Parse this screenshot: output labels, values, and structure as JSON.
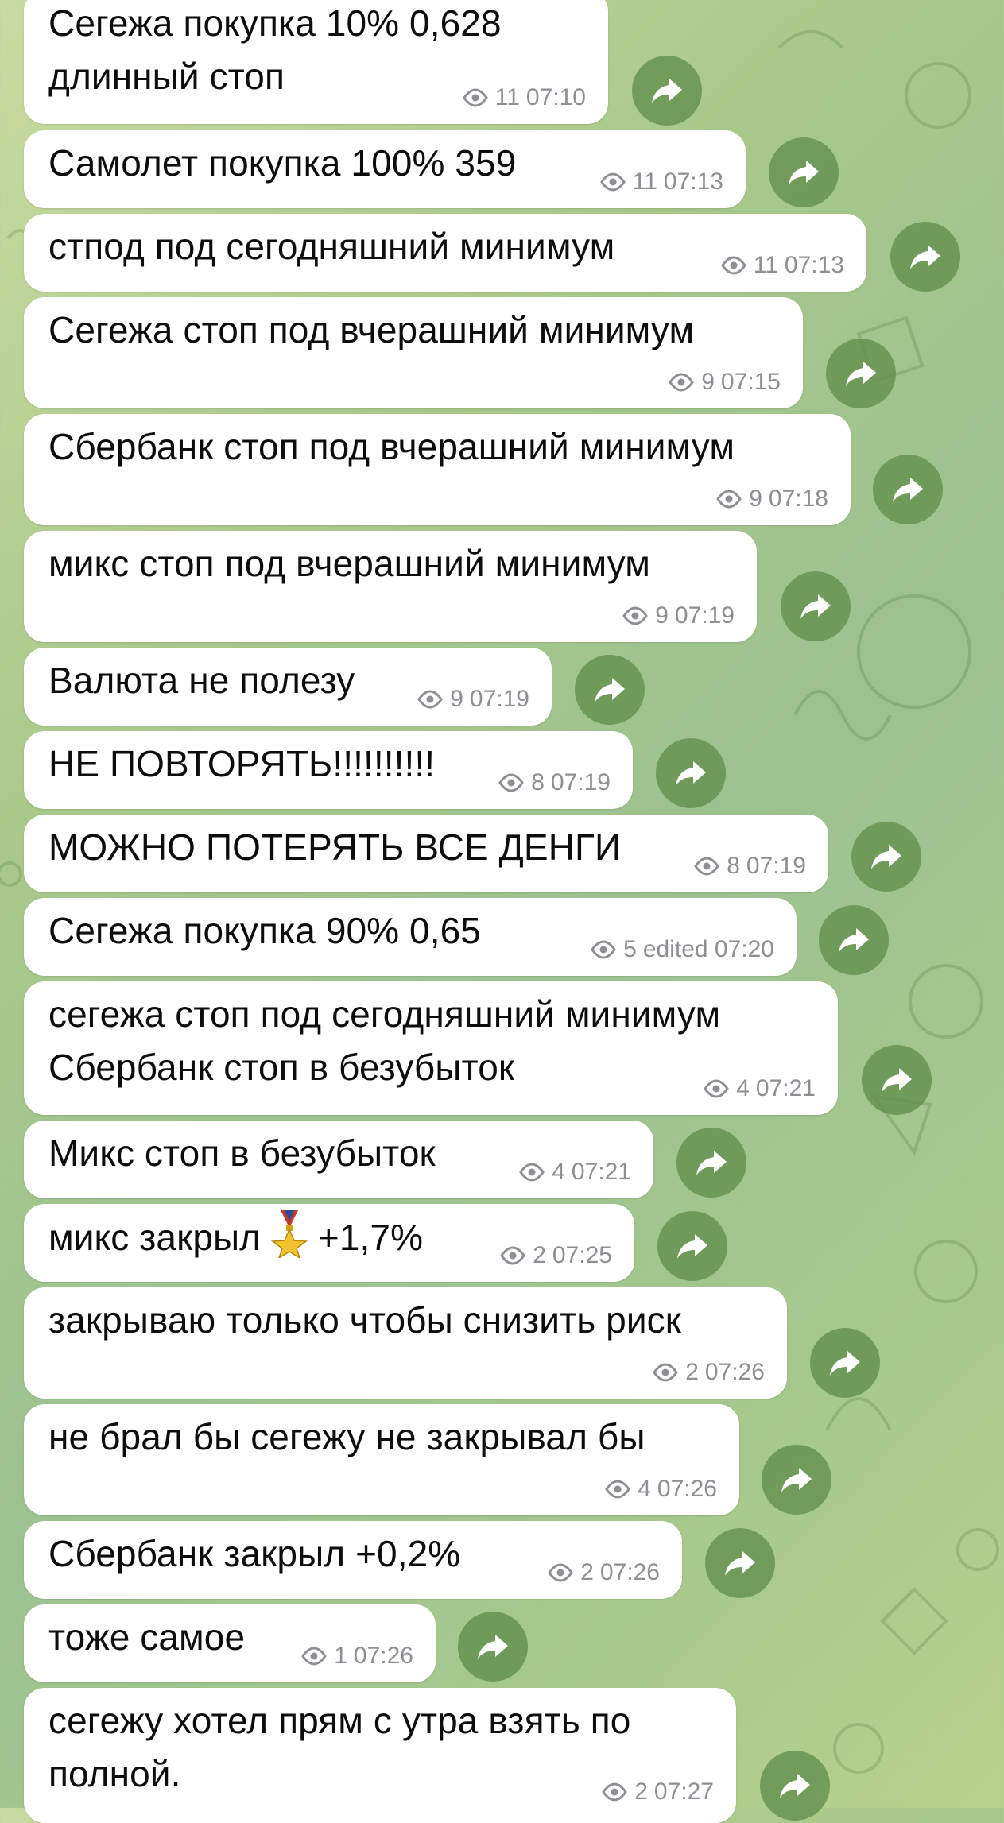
{
  "messages": [
    {
      "text": "Сегежа покупка 10% 0,628\nдлинный стоп",
      "views": "11",
      "time": "07:10"
    },
    {
      "text": "Самолет покупка 100% 359",
      "views": "11",
      "time": "07:13"
    },
    {
      "text": "стпод под сегодняшний минимум",
      "views": "11",
      "time": "07:13"
    },
    {
      "text": "Сегежа стоп под вчерашний минимум",
      "views": "9",
      "time": "07:15"
    },
    {
      "text": "Сбербанк стоп под вчерашний минимум",
      "views": "9",
      "time": "07:18"
    },
    {
      "text": "микс стоп под вчерашний минимум",
      "views": "9",
      "time": "07:19"
    },
    {
      "text": "Валюта не полезу",
      "views": "9",
      "time": "07:19"
    },
    {
      "text": "НЕ ПОВТОРЯТЬ!!!!!!!!!!",
      "views": "8",
      "time": "07:19"
    },
    {
      "text": "МОЖНО ПОТЕРЯТЬ ВСЕ ДЕНГИ",
      "views": "8",
      "time": "07:19"
    },
    {
      "text": "Сегежа покупка 90% 0,65",
      "views": "5",
      "time": "edited 07:20"
    },
    {
      "text": "сегежа стоп под сегодняшний минимум\nСбербанк стоп в безубыток",
      "views": "4",
      "time": "07:21"
    },
    {
      "text": "Микс стоп в безубыток",
      "views": "4",
      "time": "07:21"
    },
    {
      "text_before": "микс закрыл ",
      "text_after": " +1,7%",
      "emoji": "medal-icon",
      "views": "2",
      "time": "07:25"
    },
    {
      "text": "закрываю только чтобы снизить риск",
      "views": "2",
      "time": "07:26"
    },
    {
      "text": "не брал бы сегежу не закрывал бы",
      "views": "4",
      "time": "07:26"
    },
    {
      "text": "Сбербанк закрыл +0,2%",
      "views": "2",
      "time": "07:26"
    },
    {
      "text": "тоже самое",
      "views": "1",
      "time": "07:26"
    },
    {
      "text": "сегежу хотел прям с утра взять по\nполной.",
      "views": "2",
      "time": "07:27"
    }
  ],
  "colors": {
    "bubble": "#ffffff",
    "meta": "#8e8e93",
    "share_button": "#608e4c"
  }
}
